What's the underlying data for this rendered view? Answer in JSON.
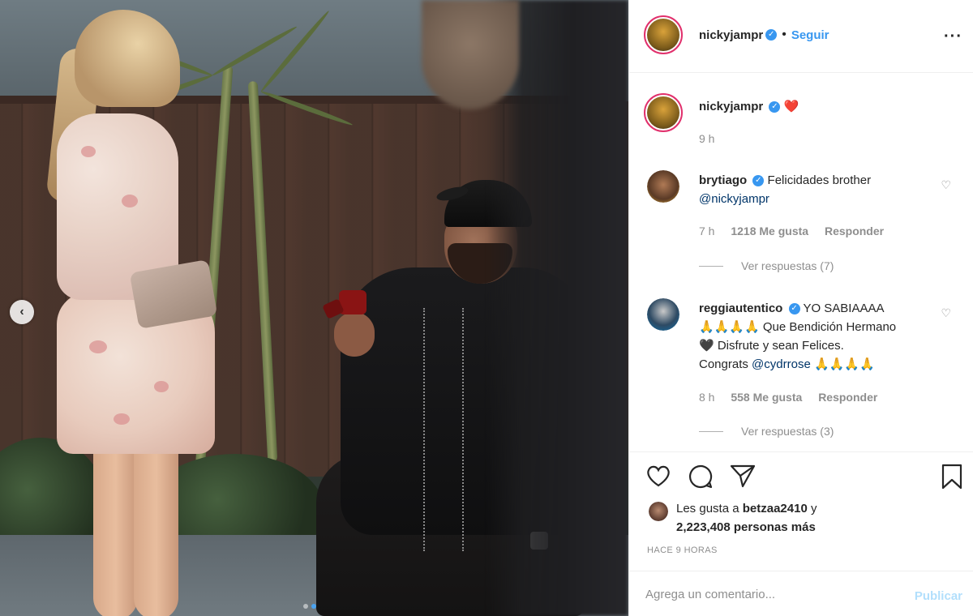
{
  "post": {
    "author": "nickyjampr",
    "follow_label": "Seguir",
    "more_label": "•••",
    "caption": "❤️",
    "caption_time": "9 h"
  },
  "comments": [
    {
      "user": "brytiago",
      "text": "Felicidades brother",
      "mention": "@nickyjampr",
      "time": "7 h",
      "likes": "1218 Me gusta",
      "reply": "Responder",
      "view_replies": "Ver respuestas (7)"
    },
    {
      "user": "reggiautentico",
      "text_line1": "YO SABIAAAA",
      "text_line2": "🙏🙏🙏🙏 Que Bendición Hermano",
      "text_line3": "🖤 Disfrute y sean Felices.",
      "text_line4_prefix": "Congrats",
      "mention": "@cydrrose",
      "text_line4_suffix": "🙏🙏🙏🙏",
      "time": "8 h",
      "likes": "558 Me gusta",
      "reply": "Responder",
      "view_replies": "Ver respuestas (3)"
    }
  ],
  "likes": {
    "prefix": "Les gusta a",
    "user": "betzaa2410",
    "joiner": "y",
    "count": "2,223,408 personas más"
  },
  "time_ago": "HACE 9 HORAS",
  "add_comment": {
    "placeholder": "Agrega un comentario...",
    "publish_label": "Publicar"
  },
  "icons": {
    "verified": "verified-badge-icon",
    "heart": "heart-icon",
    "comment": "comment-icon",
    "share": "share-icon",
    "bookmark": "bookmark-icon",
    "prev": "chevron-left-icon"
  },
  "colors": {
    "link_blue": "#3897f0",
    "muted": "#8e8e8e",
    "text": "#262626",
    "publish_disabled": "#b2dffc"
  }
}
